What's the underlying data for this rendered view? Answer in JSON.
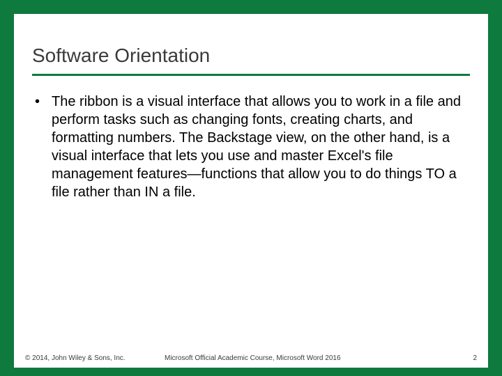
{
  "slide": {
    "title": "Software Orientation",
    "bullets": [
      "The ribbon is a visual interface that allows you to work in a file and perform tasks such as changing fonts, creating charts, and formatting numbers. The Backstage view, on the other hand, is a visual interface that lets you use and master Excel's file management features—functions that allow you to do things TO a file rather than IN a file."
    ],
    "footer": {
      "copyright": "© 2014, John Wiley & Sons, Inc.",
      "course": "Microsoft Official Academic Course, Microsoft Word 2016",
      "page": "2"
    }
  }
}
